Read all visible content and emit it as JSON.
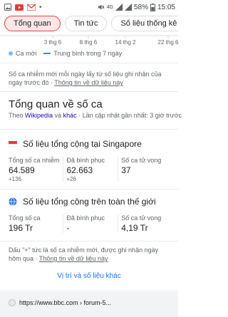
{
  "status_bar": {
    "battery": "58%",
    "time": "15:05",
    "network": "4G"
  },
  "tabs": [
    {
      "label": "Tổng quan",
      "active": true
    },
    {
      "label": "Tin tức",
      "active": false
    },
    {
      "label": "Số liệu thống kê",
      "active": false
    }
  ],
  "chart_fragment": {
    "ticks": [
      "3 thg 6",
      "8 thg 6",
      "14 thg 2",
      "22 thg 6"
    ]
  },
  "legend": {
    "new_cases": "Ca mới",
    "average": "Trung bình trong 7 ngày"
  },
  "note_top": {
    "text": "Số ca nhiễm mới mỗi ngày lấy từ số liệu ghi nhận của ngày trước đó ·",
    "link": "Thông tin về dữ liệu này"
  },
  "overview": {
    "title": "Tổng quan về số ca",
    "source_prefix": "Theo",
    "source_wiki": "Wikipedia",
    "source_and": "và",
    "source_other": "khác",
    "source_updated": "· Lần cập nhật gần nhất: 3 giờ trước"
  },
  "singapore": {
    "title": "Số liệu tổng cộng tại Singapore",
    "stats": [
      {
        "label": "Tổng số ca nhiễm",
        "value": "64.589",
        "delta": "+136"
      },
      {
        "label": "Đã bình phục",
        "value": "62.663",
        "delta": "+26"
      },
      {
        "label": "Số ca tử vong",
        "value": "37",
        "delta": ""
      }
    ]
  },
  "world": {
    "title": "Số liệu tổng cộng trên toàn thế giới",
    "stats": [
      {
        "label": "Tổng số ca",
        "value": "196 Tr",
        "delta": ""
      },
      {
        "label": "Đã bình phục",
        "value": "-",
        "delta": ""
      },
      {
        "label": "Số ca tử vong",
        "value": "4,19 Tr",
        "delta": ""
      }
    ]
  },
  "note_bottom": {
    "text": "Dấu \"+\" tức là số ca nhiễm mới, được ghi nhận ngày hôm qua ·",
    "link": "Thông tin về dữ liệu này"
  },
  "more_link": "Vị trí và số liệu khác",
  "bottom_url": "https://www.bbc.com › forum-5..."
}
